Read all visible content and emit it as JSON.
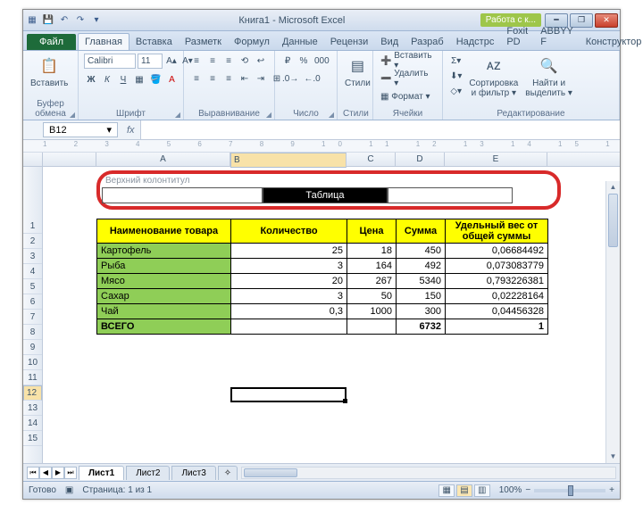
{
  "window": {
    "title": "Книга1  -  Microsoft Excel",
    "context_tab": "Работа с к...",
    "min": "━",
    "max": "❐",
    "close": "✕"
  },
  "tabs": {
    "file": "Файл",
    "items": [
      "Главная",
      "Вставка",
      "Разметк",
      "Формул",
      "Данные",
      "Рецензи",
      "Вид",
      "Разраб",
      "Надстрс",
      "Foxit PD",
      "ABBYY F",
      "Конструктор"
    ],
    "active": "Главная",
    "help": "ˆ  ?"
  },
  "ribbon": {
    "clipboard": {
      "paste": "Вставить",
      "label": "Буфер обмена"
    },
    "font": {
      "name": "Calibri",
      "size": "11",
      "label": "Шрифт"
    },
    "align": {
      "label": "Выравнивание"
    },
    "number": {
      "label": "Число"
    },
    "styles": {
      "label": "Стили",
      "btn": "Стили"
    },
    "cells": {
      "insert": "Вставить ▾",
      "delete": "Удалить ▾",
      "format": "Формат ▾",
      "label": "Ячейки"
    },
    "editing": {
      "sort": "Сортировка\nи фильтр ▾",
      "find": "Найти и\nвыделить ▾",
      "label": "Редактирование"
    }
  },
  "formula_bar": {
    "cell": "B12",
    "fx": "fx"
  },
  "ruler_ticks": "1  2  3  4  5  6  7  8  9  10  11  12  13  14  15  16",
  "columns": [
    "A",
    "B",
    "C",
    "D",
    "E"
  ],
  "rows": [
    "1",
    "2",
    "3",
    "4",
    "5",
    "6",
    "7",
    "8",
    "9",
    "10",
    "11",
    "12",
    "13",
    "14",
    "15"
  ],
  "header_zone": {
    "label": "Верхний колонтитул",
    "center": "Таблица"
  },
  "table": {
    "headers": [
      "Наименование товара",
      "Количество",
      "Цена",
      "Сумма",
      "Удельный вес от общей суммы"
    ],
    "rows": [
      {
        "n": "Картофель",
        "q": "25",
        "p": "18",
        "s": "450",
        "u": "0,06684492"
      },
      {
        "n": "Рыба",
        "q": "3",
        "p": "164",
        "s": "492",
        "u": "0,073083779"
      },
      {
        "n": "Мясо",
        "q": "20",
        "p": "267",
        "s": "5340",
        "u": "0,793226381"
      },
      {
        "n": "Сахар",
        "q": "3",
        "p": "50",
        "s": "150",
        "u": "0,02228164"
      },
      {
        "n": "Чай",
        "q": "0,3",
        "p": "1000",
        "s": "300",
        "u": "0,04456328"
      }
    ],
    "total": {
      "n": "ВСЕГО",
      "s": "6732",
      "u": "1"
    }
  },
  "sheet_tabs": {
    "items": [
      "Лист1",
      "Лист2",
      "Лист3"
    ],
    "active": "Лист1",
    "add": "+"
  },
  "status": {
    "ready": "Готово",
    "page": "Страница: 1 из 1",
    "zoom": "100%",
    "minus": "−",
    "plus": "+"
  }
}
